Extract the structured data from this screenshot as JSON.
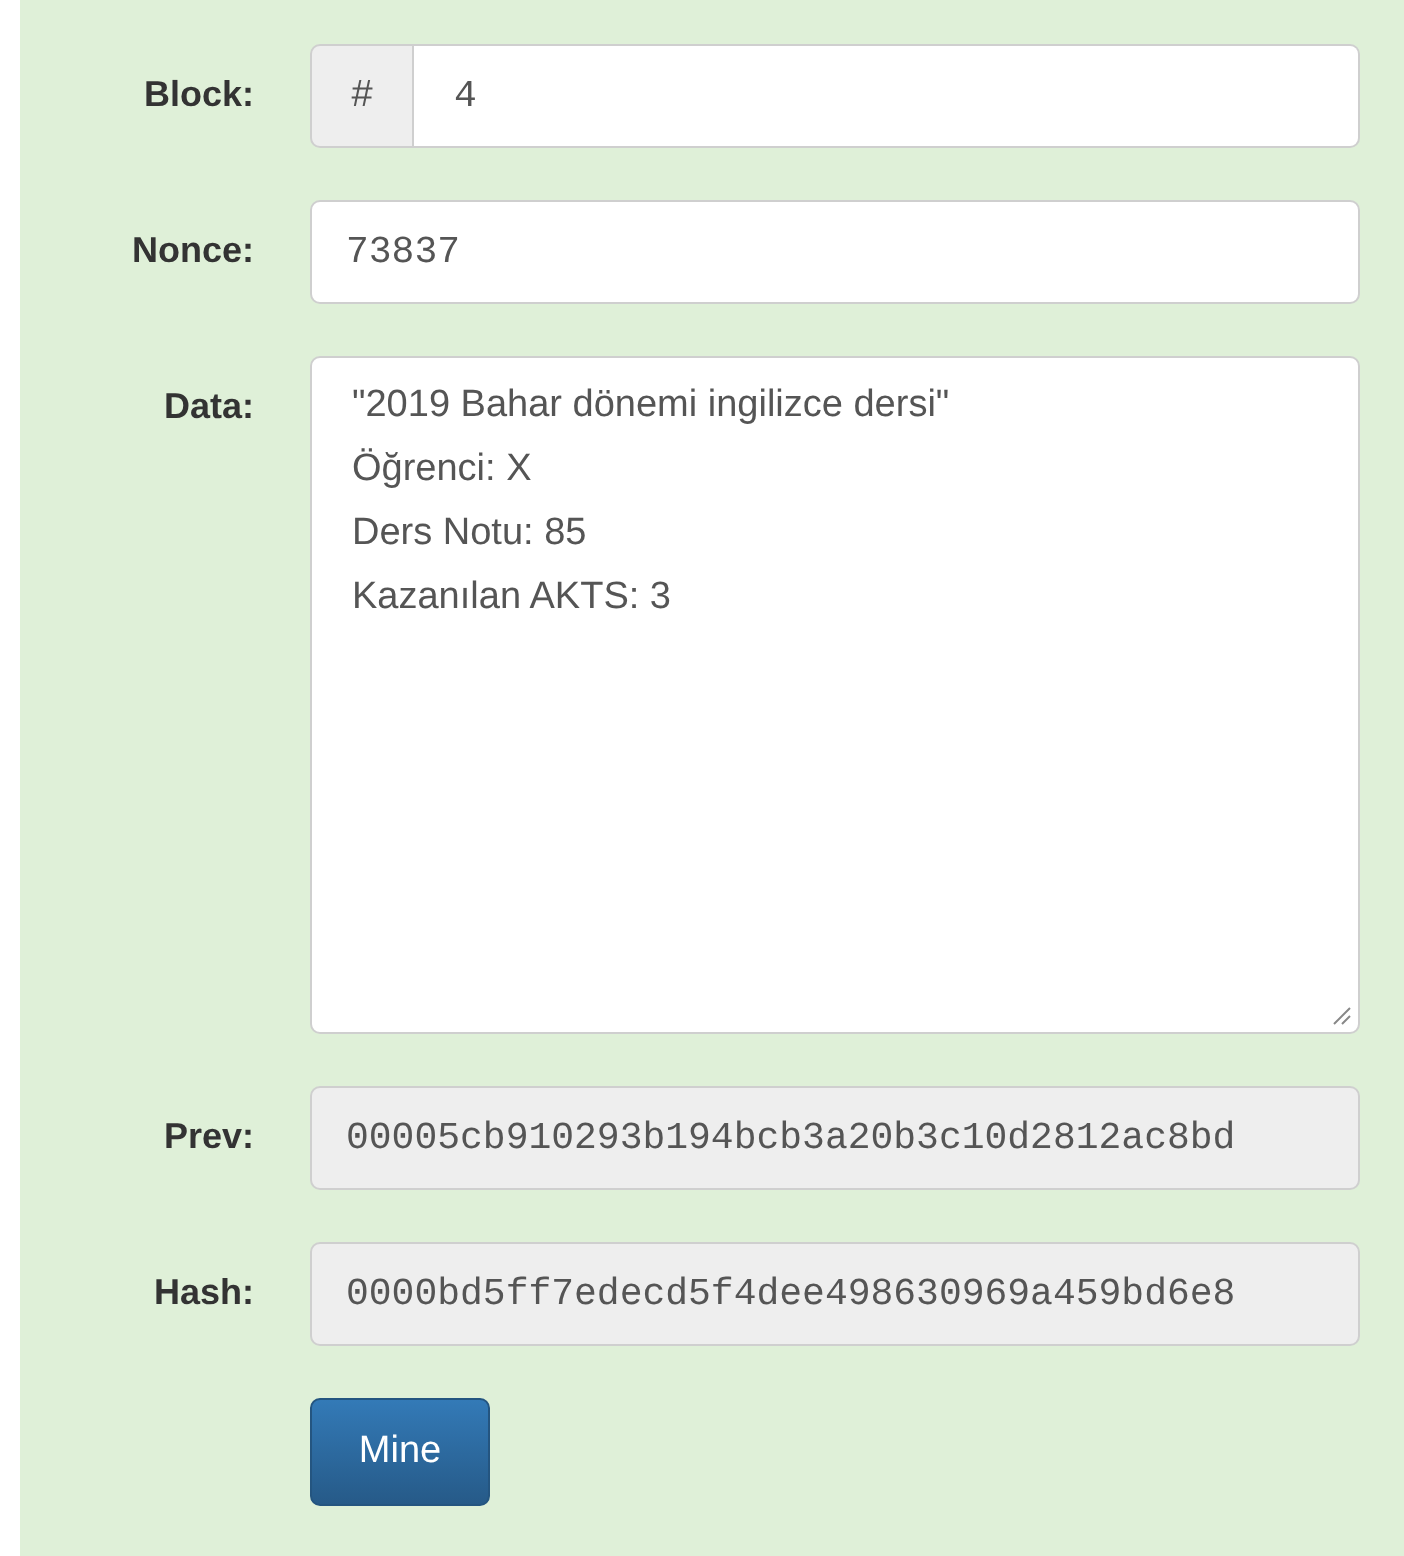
{
  "fields": [
    {
      "kind": "addon",
      "label": "Block:",
      "addon": "#",
      "value": "4",
      "disabled": false
    },
    {
      "kind": "text",
      "label": "Nonce:",
      "value": "73837",
      "disabled": false
    },
    {
      "kind": "textarea",
      "label": "Data:",
      "lines": [
        "\"2019 Bahar dönemi ingilizce dersi\"",
        "Öğrenci: X",
        "Ders Notu: 85",
        "Kazanılan AKTS: 3"
      ],
      "disabled": false
    },
    {
      "kind": "text",
      "label": "Prev:",
      "value": "00005cb910293b194bcb3a20b3c10d2812ac8bd",
      "disabled": true
    },
    {
      "kind": "text",
      "label": "Hash:",
      "value": "0000bd5ff7edecd5f4dee498630969a459bd6e8",
      "disabled": true
    }
  ],
  "button": {
    "label": "Mine"
  }
}
